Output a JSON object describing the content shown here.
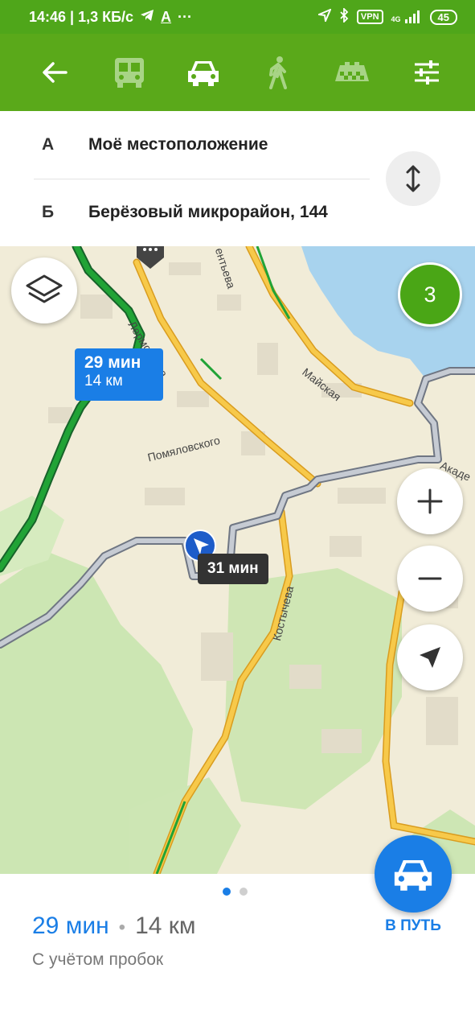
{
  "status_bar": {
    "time_speed": "14:46 | 1,3 КБ/с",
    "dots": "···",
    "vpn": "VPN",
    "network": "4G",
    "battery": "45"
  },
  "toolbar": {
    "icons": [
      "back-arrow-icon",
      "bus-icon",
      "car-icon",
      "pedestrian-icon",
      "taxi-icon",
      "settings-sliders-icon"
    ],
    "active_mode": "car"
  },
  "route": {
    "from_marker": "А",
    "from_label": "Моё местоположение",
    "to_marker": "Б",
    "to_label": "Берёзовый микрорайон, 144"
  },
  "map": {
    "streets": {
      "lermontova": "Лермонтова",
      "terentyeva": "ентьева",
      "mayskaya": "Майская",
      "pomyalovskogo": "Помяловского",
      "kostycheva": "Костычева",
      "akad": "Акаде"
    },
    "route_main": {
      "time": "29 мин",
      "distance": "14 км"
    },
    "route_alt": {
      "time": "31 мин"
    },
    "layer_count": "3",
    "colors": {
      "route_green": "#21a336",
      "route_gray": "#c6cbd3",
      "road_yellow": "#f5b52b",
      "water": "#a8d3ee",
      "forest": "#cde6b4"
    }
  },
  "summary": {
    "time": "29 мин",
    "separator": "•",
    "distance": "14 км",
    "note": "С учётом пробок",
    "go_label": "В ПУТЬ",
    "page_current": 1,
    "page_total": 2
  }
}
